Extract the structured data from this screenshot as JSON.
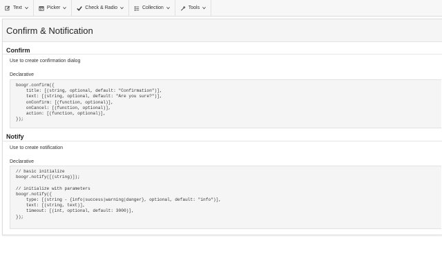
{
  "navbar": {
    "items": [
      {
        "label": "Text",
        "icon": "edit-icon"
      },
      {
        "label": "Picker",
        "icon": "calendar-icon"
      },
      {
        "label": "Check & Radio",
        "icon": "check-icon"
      },
      {
        "label": "Collection",
        "icon": "list-icon"
      },
      {
        "label": "Tools",
        "icon": "wrench-icon"
      }
    ]
  },
  "page": {
    "title": "Confirm & Notification"
  },
  "confirm": {
    "title": "Confirm",
    "description": "Use to create confirmation dialog",
    "declarative_label": "Declarative",
    "code": "boogr.confirm({\n    title: [(string, optional, default: \"Confirmation\")],\n    text: [(string, optional, default: \"Are you sure?\")],\n    onConfirm: [(function, optional)],\n    onCancel: [(function, optional)],\n    action: [(function, optional)],\n});"
  },
  "notify": {
    "title": "Notify",
    "description": "Use to create notification",
    "declarative_label": "Declarative",
    "code": "// basic initialize\nboogr.notify([(string)]);\n\n// initialize with parameters\nboogr.notify({\n    type: [(string - {info|success|warning|danger}, optional, default: \"info\")],\n    text: [(string, text)],\n    timeout: [(int, optional, default: 3000)],\n});"
  }
}
